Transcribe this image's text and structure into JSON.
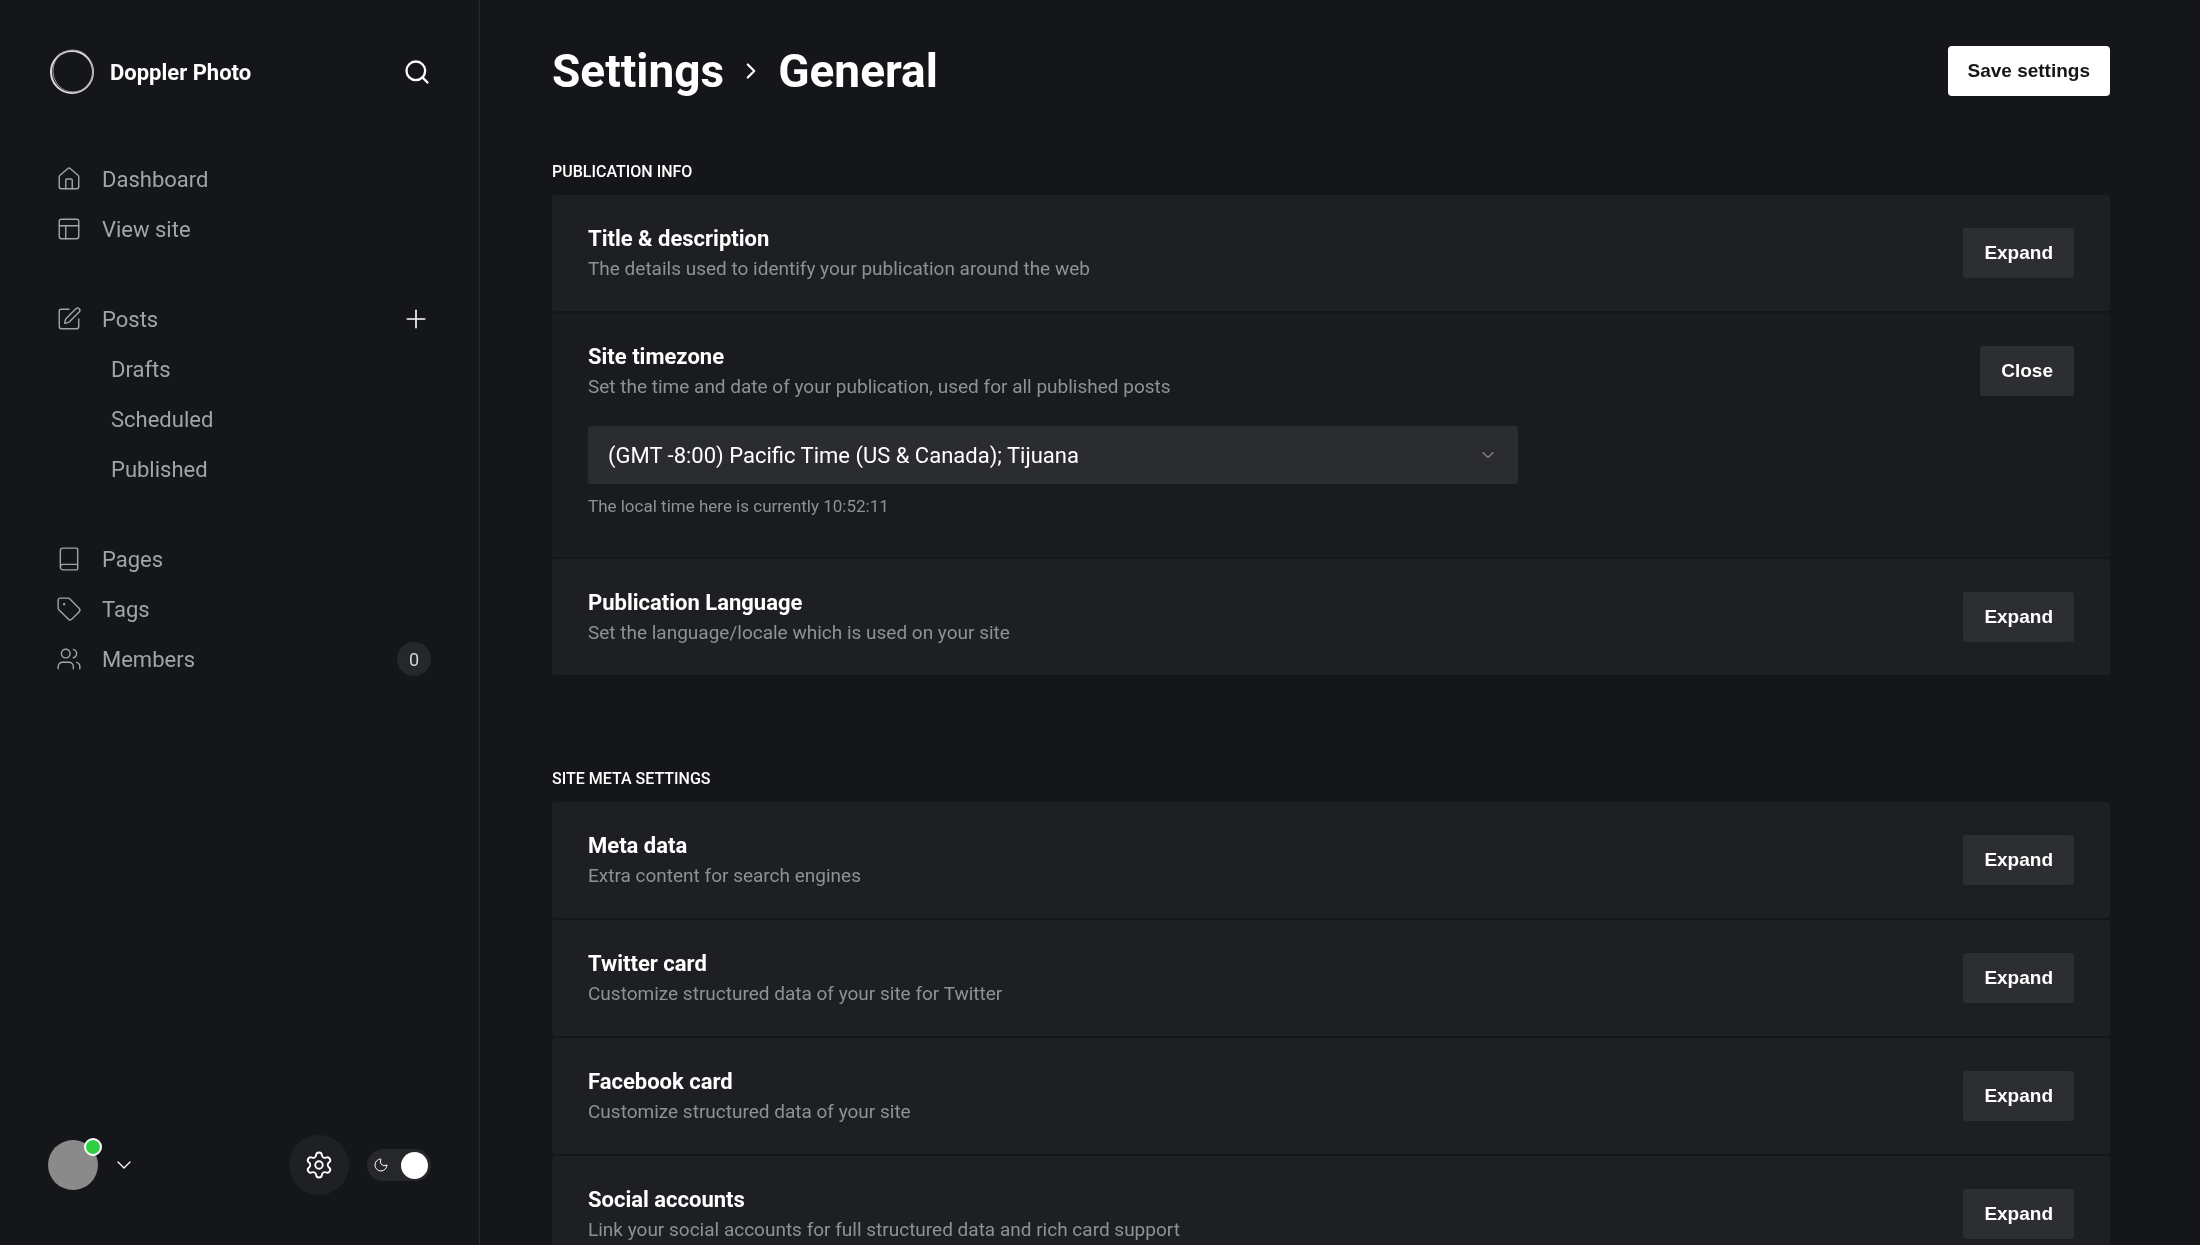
{
  "sidebar": {
    "brand": "Doppler Photo",
    "nav_groups": [
      {
        "items": [
          {
            "label": "Dashboard"
          },
          {
            "label": "View site"
          }
        ]
      },
      {
        "items": [
          {
            "label": "Posts",
            "children": [
              {
                "label": "Drafts"
              },
              {
                "label": "Scheduled"
              },
              {
                "label": "Published"
              }
            ]
          }
        ]
      },
      {
        "items": [
          {
            "label": "Pages"
          },
          {
            "label": "Tags"
          },
          {
            "label": "Members",
            "count": "0"
          }
        ]
      }
    ],
    "user": {
      "online": true,
      "color": "#30cf43"
    },
    "dark_mode": {
      "on": true
    }
  },
  "header": {
    "crumbs": [
      "Settings",
      "General"
    ],
    "save_button": "Save settings"
  },
  "sections": [
    {
      "title": "PUBLICATION INFO",
      "items": [
        {
          "title": "Title & description",
          "description": "The details used to identify your publication around the web",
          "button": "Expand",
          "expanded": false
        },
        {
          "title": "Site timezone",
          "description": "Set the time and date of your publication, used for all published posts",
          "button": "Close",
          "expanded": true,
          "select_value": "(GMT -8:00) Pacific Time (US & Canada); Tijuana",
          "hint": "The local time here is currently 10:52:11"
        },
        {
          "title": "Publication Language",
          "description": "Set the language/locale which is used on your site",
          "button": "Expand",
          "expanded": false
        }
      ]
    },
    {
      "title": "SITE META SETTINGS",
      "items": [
        {
          "title": "Meta data",
          "description": "Extra content for search engines",
          "button": "Expand",
          "expanded": false
        },
        {
          "title": "Twitter card",
          "description": "Customize structured data of your site for Twitter",
          "button": "Expand",
          "expanded": false
        },
        {
          "title": "Facebook card",
          "description": "Customize structured data of your site",
          "button": "Expand",
          "expanded": false
        },
        {
          "title": "Social accounts",
          "description": "Link your social accounts for full structured data and rich card support",
          "button": "Expand",
          "expanded": false
        }
      ]
    }
  ]
}
